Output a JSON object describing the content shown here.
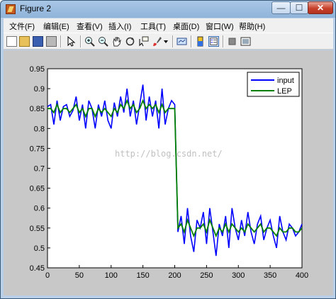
{
  "window": {
    "title": "Figure 2",
    "min_glyph": "—",
    "max_glyph": "☐",
    "close_glyph": "✕"
  },
  "menu": [
    "文件(F)",
    "编辑(E)",
    "查看(V)",
    "插入(I)",
    "工具(T)",
    "桌面(D)",
    "窗口(W)",
    "帮助(H)"
  ],
  "toolbar_icons": [
    "new-figure-icon",
    "open-file-icon",
    "save-icon",
    "print-icon",
    "edit-plot-arrow-icon",
    "zoom-in-icon",
    "zoom-out-icon",
    "pan-hand-icon",
    "rotate-3d-icon",
    "data-cursor-icon",
    "brush-icon",
    "brush-dropdown-icon",
    "link-plot-icon",
    "colorbar-icon",
    "legend-icon",
    "hide-plot-tools-icon",
    "show-plot-tools-icon"
  ],
  "watermark": "http://blog.csdn.net/",
  "colors": {
    "input": "#0000ff",
    "LEP": "#008000"
  },
  "chart_data": {
    "type": "line",
    "xlim": [
      0,
      400
    ],
    "ylim": [
      0.45,
      0.95
    ],
    "xticks": [
      "0",
      "50",
      "100",
      "150",
      "200",
      "250",
      "300",
      "350",
      "400"
    ],
    "yticks": [
      "0.45",
      "0.5",
      "0.55",
      "0.6",
      "0.65",
      "0.7",
      "0.75",
      "0.8",
      "0.85",
      "0.9",
      "0.95"
    ],
    "legend": {
      "position": "top-right",
      "entries": [
        "input",
        "LEP"
      ]
    },
    "grid": false,
    "series": [
      {
        "name": "input",
        "color": "#0000ff",
        "x": [
          0,
          5,
          10,
          15,
          20,
          25,
          30,
          35,
          40,
          45,
          50,
          55,
          60,
          65,
          70,
          75,
          80,
          85,
          90,
          95,
          100,
          105,
          110,
          115,
          120,
          125,
          130,
          135,
          140,
          145,
          150,
          155,
          160,
          165,
          170,
          175,
          180,
          185,
          190,
          195,
          200,
          205,
          210,
          215,
          220,
          225,
          230,
          235,
          240,
          245,
          250,
          255,
          260,
          265,
          270,
          275,
          280,
          285,
          290,
          295,
          300,
          305,
          310,
          315,
          320,
          325,
          330,
          335,
          340,
          345,
          350,
          355,
          360,
          365,
          370,
          375,
          380,
          385,
          390,
          395,
          400
        ],
        "y": [
          0.855,
          0.86,
          0.81,
          0.87,
          0.82,
          0.855,
          0.86,
          0.83,
          0.845,
          0.88,
          0.82,
          0.86,
          0.8,
          0.87,
          0.85,
          0.8,
          0.86,
          0.83,
          0.87,
          0.82,
          0.8,
          0.865,
          0.83,
          0.88,
          0.84,
          0.9,
          0.83,
          0.87,
          0.81,
          0.86,
          0.91,
          0.82,
          0.88,
          0.83,
          0.87,
          0.8,
          0.9,
          0.81,
          0.85,
          0.87,
          0.86,
          0.54,
          0.58,
          0.51,
          0.6,
          0.53,
          0.49,
          0.57,
          0.55,
          0.59,
          0.51,
          0.6,
          0.54,
          0.48,
          0.56,
          0.53,
          0.58,
          0.5,
          0.6,
          0.55,
          0.52,
          0.57,
          0.53,
          0.59,
          0.54,
          0.51,
          0.56,
          0.58,
          0.52,
          0.55,
          0.57,
          0.53,
          0.5,
          0.58,
          0.54,
          0.52,
          0.56,
          0.55,
          0.53,
          0.54,
          0.56
        ]
      },
      {
        "name": "LEP",
        "color": "#008000",
        "x": [
          0,
          5,
          10,
          15,
          20,
          25,
          30,
          35,
          40,
          45,
          50,
          55,
          60,
          65,
          70,
          75,
          80,
          85,
          90,
          95,
          100,
          105,
          110,
          115,
          120,
          125,
          130,
          135,
          140,
          145,
          150,
          155,
          160,
          165,
          170,
          175,
          180,
          185,
          190,
          195,
          200,
          205,
          210,
          215,
          220,
          225,
          230,
          235,
          240,
          245,
          250,
          255,
          260,
          265,
          270,
          275,
          280,
          285,
          290,
          295,
          300,
          305,
          310,
          315,
          320,
          325,
          330,
          335,
          340,
          345,
          350,
          355,
          360,
          365,
          370,
          375,
          380,
          385,
          390,
          395,
          400
        ],
        "y": [
          0.85,
          0.85,
          0.84,
          0.86,
          0.84,
          0.85,
          0.85,
          0.84,
          0.85,
          0.86,
          0.84,
          0.85,
          0.83,
          0.85,
          0.85,
          0.83,
          0.85,
          0.84,
          0.85,
          0.84,
          0.83,
          0.85,
          0.84,
          0.86,
          0.85,
          0.87,
          0.85,
          0.86,
          0.84,
          0.85,
          0.87,
          0.85,
          0.86,
          0.85,
          0.86,
          0.84,
          0.86,
          0.84,
          0.85,
          0.85,
          0.85,
          0.55,
          0.56,
          0.54,
          0.57,
          0.55,
          0.53,
          0.55,
          0.55,
          0.56,
          0.54,
          0.57,
          0.55,
          0.53,
          0.55,
          0.54,
          0.56,
          0.54,
          0.56,
          0.55,
          0.54,
          0.55,
          0.54,
          0.56,
          0.55,
          0.54,
          0.55,
          0.56,
          0.54,
          0.55,
          0.55,
          0.54,
          0.53,
          0.55,
          0.54,
          0.54,
          0.55,
          0.55,
          0.54,
          0.54,
          0.55
        ]
      }
    ]
  }
}
